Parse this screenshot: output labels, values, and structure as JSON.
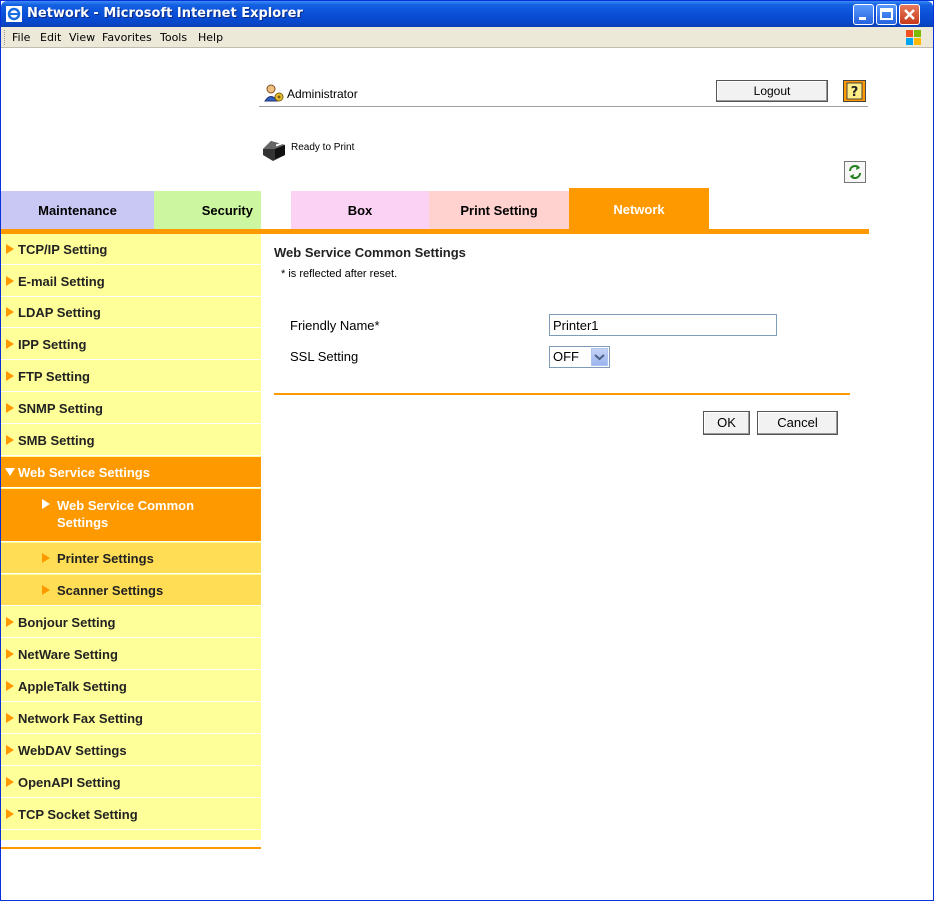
{
  "window": {
    "title": "Network - Microsoft Internet Explorer"
  },
  "menu": {
    "items": [
      "File",
      "Edit",
      "View",
      "Favorites",
      "Tools",
      "Help"
    ]
  },
  "header": {
    "user_label": "Administrator",
    "logout_label": "Logout",
    "help_label": "?",
    "status_label": "Ready to Print"
  },
  "tabs": [
    {
      "label": "Maintenance",
      "color": "#c9c8f4"
    },
    {
      "label": "Security",
      "color": "#ccf7a0"
    },
    {
      "label": "Box",
      "color": "#fcd2f4"
    },
    {
      "label": "Print Setting",
      "color": "#ffd1cf"
    },
    {
      "label": "Network",
      "color": "#ff9900",
      "selected": true
    }
  ],
  "sidebar": {
    "items": [
      {
        "label": "TCP/IP Setting"
      },
      {
        "label": "E-mail Setting"
      },
      {
        "label": "LDAP Setting"
      },
      {
        "label": "IPP Setting"
      },
      {
        "label": "FTP Setting"
      },
      {
        "label": "SNMP Setting"
      },
      {
        "label": "SMB Setting"
      },
      {
        "label": "Web Service Settings",
        "expanded": true
      },
      {
        "label": "Web Service Common Settings",
        "sub": true,
        "current": true
      },
      {
        "label": "Printer Settings",
        "sub": true
      },
      {
        "label": "Scanner Settings",
        "sub": true
      },
      {
        "label": "Bonjour Setting"
      },
      {
        "label": "NetWare Setting"
      },
      {
        "label": "AppleTalk Setting"
      },
      {
        "label": "Network Fax Setting"
      },
      {
        "label": "WebDAV Settings"
      },
      {
        "label": "OpenAPI Setting"
      },
      {
        "label": "TCP Socket Setting"
      }
    ]
  },
  "content": {
    "title": "Web Service Common Settings",
    "note": "* is reflected after reset.",
    "fields": {
      "friendly_name": {
        "label": "Friendly Name*",
        "value": "Printer1"
      },
      "ssl": {
        "label": "SSL Setting",
        "value": "OFF"
      }
    },
    "ok_label": "OK",
    "cancel_label": "Cancel"
  },
  "colors": {
    "accent": "#ff9900",
    "sidebar_bg": "#ffff99",
    "sub_bg": "#ffdd55"
  }
}
